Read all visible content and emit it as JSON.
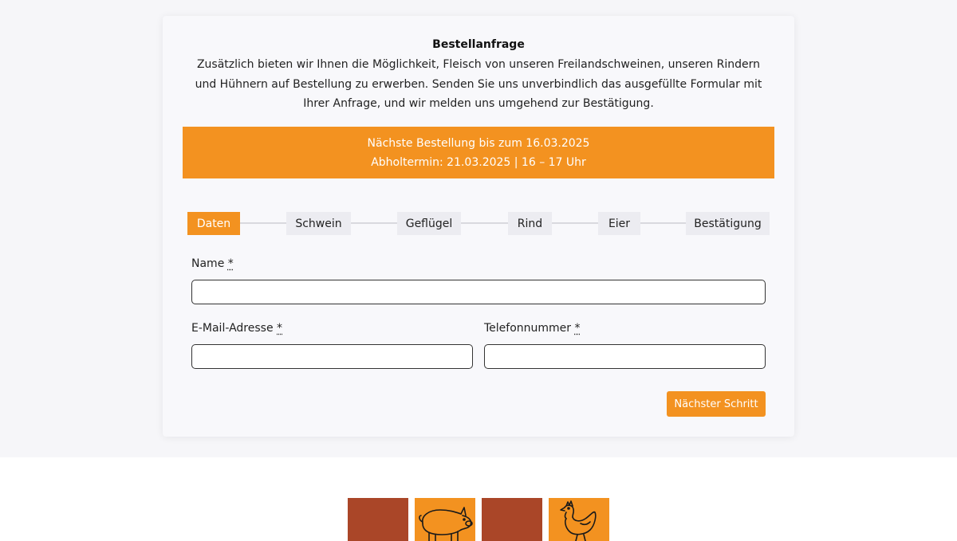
{
  "form": {
    "title": "Bestellanfrage",
    "intro": "Zusätzlich bieten wir Ihnen die Möglichkeit, Fleisch von unseren Freilandschweinen, unseren Rindern und Hühnern auf Bestellung zu erwerben. Senden Sie uns unverbindlich das ausgefüllte Formular mit Ihrer Anfrage, und wir melden uns umgehend zur Bestätigung.",
    "notice": {
      "line1": "Nächste Bestellung bis zum 16.03.2025",
      "line2": "Abholtermin: 21.03.2025 | 16 – 17 Uhr"
    },
    "steps": [
      {
        "label": "Daten",
        "active": true
      },
      {
        "label": "Schwein",
        "active": false
      },
      {
        "label": "Geflügel",
        "active": false
      },
      {
        "label": "Rind",
        "active": false
      },
      {
        "label": "Eier",
        "active": false
      },
      {
        "label": "Bestätigung",
        "active": false
      }
    ],
    "fields": {
      "name": {
        "label": "Name",
        "required_mark": "*",
        "value": ""
      },
      "email": {
        "label": "E-Mail-Adresse",
        "required_mark": "*",
        "value": ""
      },
      "phone": {
        "label": "Telefonnummer",
        "required_mark": "*",
        "value": ""
      }
    },
    "next_button": "Nächster Schritt"
  },
  "footer_tiles": [
    {
      "icon": "none",
      "color": "#aa4628"
    },
    {
      "icon": "pig-icon",
      "color": "#f39220"
    },
    {
      "icon": "none",
      "color": "#aa4628"
    },
    {
      "icon": "chicken-icon",
      "color": "#f39220"
    }
  ],
  "colors": {
    "accent": "#f39220",
    "brown": "#aa4628",
    "background": "#f6f6f9"
  }
}
